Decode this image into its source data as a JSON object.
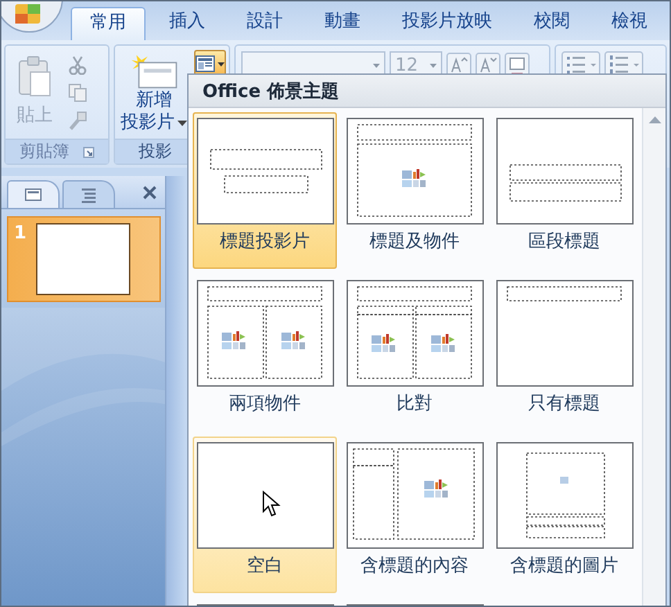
{
  "ribbon_tabs": [
    {
      "label": "常用",
      "selected": true
    },
    {
      "label": "插入",
      "selected": false
    },
    {
      "label": "設計",
      "selected": false
    },
    {
      "label": "動畫",
      "selected": false
    },
    {
      "label": "投影片放映",
      "selected": false
    },
    {
      "label": "校閱",
      "selected": false
    },
    {
      "label": "檢視",
      "selected": false
    }
  ],
  "clipboard_group": {
    "paste": {
      "label": "貼上",
      "disabled": true
    },
    "label": "剪貼簿"
  },
  "slides_group": {
    "new_slide": [
      "新增",
      "投影片"
    ],
    "layout_button": {
      "open": true
    },
    "label": "投影"
  },
  "font_group": {
    "size": "12"
  },
  "slides_panel": {
    "tabs": [
      {
        "kind": "slides",
        "selected": true
      },
      {
        "kind": "outline",
        "selected": false
      }
    ],
    "slides": [
      {
        "number": "1",
        "selected": true
      }
    ]
  },
  "layout_gallery": {
    "title": "Office 佈景主題",
    "layouts": [
      {
        "label": "標題投影片",
        "kind": "title",
        "selected": true,
        "hovered": false
      },
      {
        "label": "標題及物件",
        "kind": "title-content",
        "selected": false,
        "hovered": false
      },
      {
        "label": "區段標題",
        "kind": "section",
        "selected": false,
        "hovered": false
      },
      {
        "label": "兩項物件",
        "kind": "two-content",
        "selected": false,
        "hovered": false
      },
      {
        "label": "比對",
        "kind": "comparison",
        "selected": false,
        "hovered": false
      },
      {
        "label": "只有標題",
        "kind": "title-only",
        "selected": false,
        "hovered": false
      },
      {
        "label": "空白",
        "kind": "blank",
        "selected": false,
        "hovered": true
      },
      {
        "label": "含標題的內容",
        "kind": "content-caption",
        "selected": false,
        "hovered": false
      },
      {
        "label": "含標題的圖片",
        "kind": "picture-caption",
        "selected": false,
        "hovered": false
      },
      {
        "kind": "cut",
        "selected": false,
        "hovered": false
      },
      {
        "kind": "cut",
        "selected": false,
        "hovered": false
      }
    ]
  }
}
